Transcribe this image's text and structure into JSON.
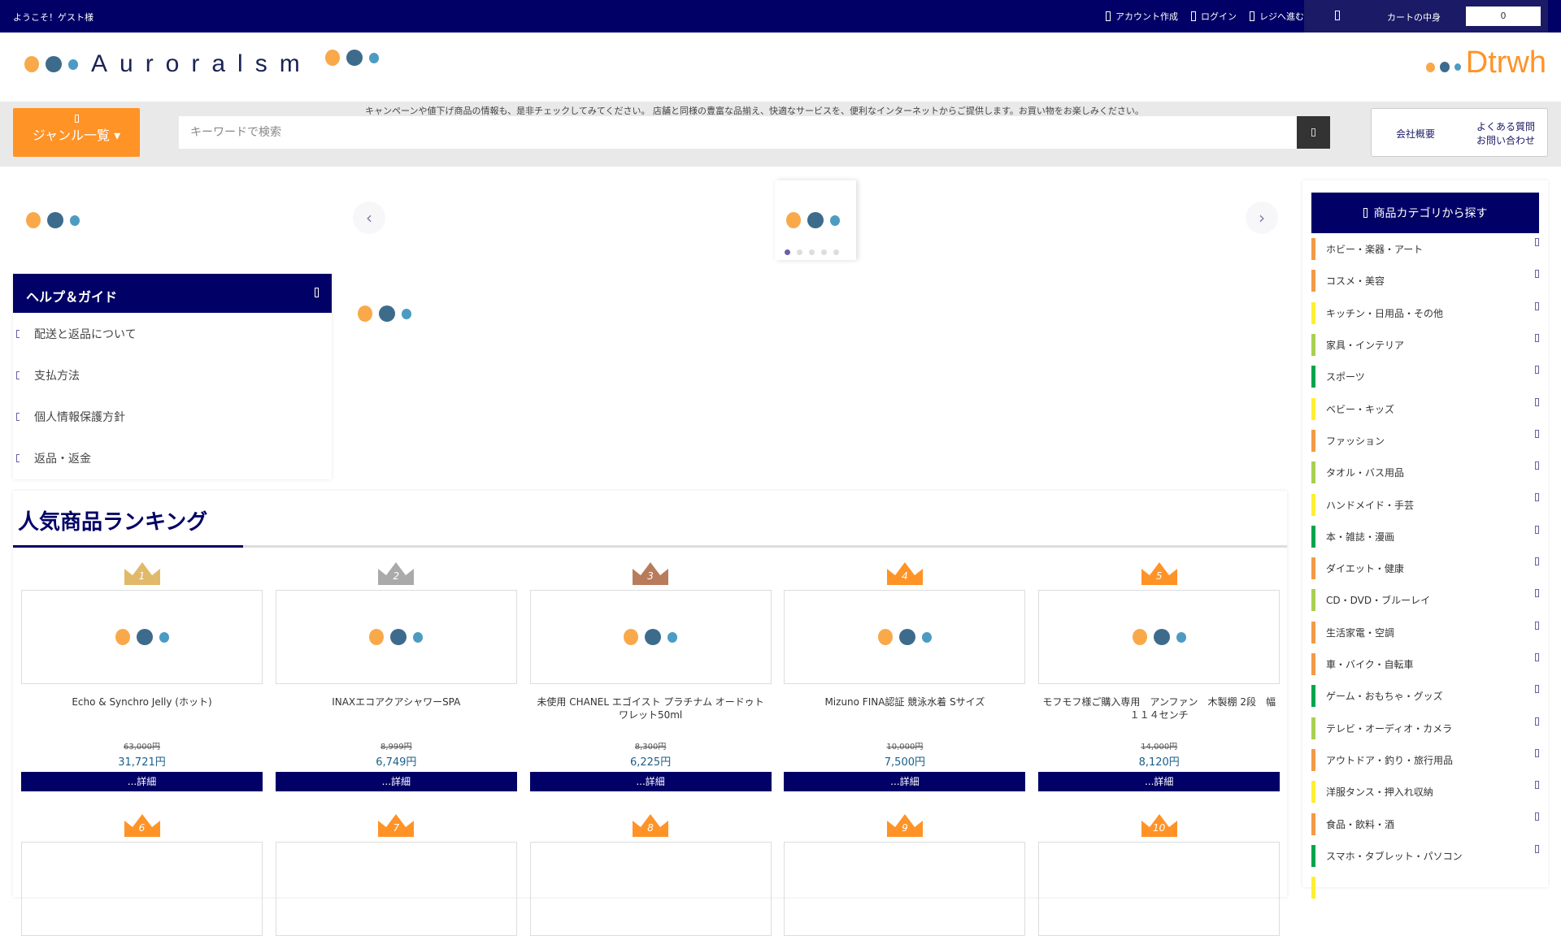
{
  "topbar": {
    "welcome": "ようこそ！ゲスト様",
    "links": [
      "アカウント作成",
      "ログイン",
      "レジへ進む"
    ],
    "cart_label": "カートの中身",
    "cart_count": "0"
  },
  "header": {
    "logo": "Auroralsm",
    "right_logo": "Dtrwh"
  },
  "band": {
    "genre_button": "ジャンル一覧",
    "campaign": "キャンペーンや値下げ商品の情報も、是非チェックしてみてください。 店舗と同様の豊富な品揃え、快適なサービスを、便利なインターネットからご提供します。お買い物をお楽しみください。",
    "search_placeholder": "キーワードで検索",
    "company": "会社概要",
    "faq": "よくある質問",
    "contact": "お問い合わせ"
  },
  "help": {
    "title": "ヘルプ＆ガイド",
    "items": [
      "配送と返品について",
      "支払方法",
      "個人情報保護方針",
      "返品・返金"
    ]
  },
  "ranking": {
    "title": "人気商品ランキング",
    "detail_label": "...詳細",
    "products": [
      {
        "rank": "1",
        "name": "Echo & Synchro Jelly (ホット)",
        "old_price": "63,000円",
        "price": "31,721円"
      },
      {
        "rank": "2",
        "name": "INAXエコアクアシャワーSPA",
        "old_price": "8,999円",
        "price": "6,749円"
      },
      {
        "rank": "3",
        "name": "未使用 CHANEL エゴイスト プラチナム オードゥトワレット50ml",
        "old_price": "8,300円",
        "price": "6,225円"
      },
      {
        "rank": "4",
        "name": "Mizuno FINA認証 競泳水着 Sサイズ",
        "old_price": "10,000円",
        "price": "7,500円"
      },
      {
        "rank": "5",
        "name": "モフモフ様ご購入専用　アンファン　木製棚 2段　幅１１４センチ",
        "old_price": "14,000円",
        "price": "8,120円"
      }
    ],
    "row2_ranks": [
      "6",
      "7",
      "8",
      "9",
      "10"
    ]
  },
  "crown_colors": {
    "1": "#e0b96a",
    "2": "#aaaaaa",
    "3": "#b87c5c",
    "other": "#ff9326"
  },
  "sidebar": {
    "title": "商品カテゴリから探す",
    "categories": [
      {
        "label": "ホビー・楽器・アート",
        "color": "#f39a45"
      },
      {
        "label": "コスメ・美容",
        "color": "#f39a45"
      },
      {
        "label": "キッチン・日用品・その他",
        "color": "#ffee33"
      },
      {
        "label": "家具・インテリア",
        "color": "#a8d050"
      },
      {
        "label": "スポーツ",
        "color": "#00a550"
      },
      {
        "label": "ベビー・キッズ",
        "color": "#ffee33"
      },
      {
        "label": "ファッション",
        "color": "#f39a45"
      },
      {
        "label": "タオル・バス用品",
        "color": "#a8d050"
      },
      {
        "label": "ハンドメイド・手芸",
        "color": "#ffee33"
      },
      {
        "label": "本・雑誌・漫画",
        "color": "#00a550"
      },
      {
        "label": "ダイエット・健康",
        "color": "#f39a45"
      },
      {
        "label": "CD・DVD・ブルーレイ",
        "color": "#a8d050"
      },
      {
        "label": "生活家電・空調",
        "color": "#f39a45"
      },
      {
        "label": "車・バイク・自転車",
        "color": "#f39a45"
      },
      {
        "label": "ゲーム・おもちゃ・グッズ",
        "color": "#00a550"
      },
      {
        "label": "テレビ・オーディオ・カメラ",
        "color": "#a8d050"
      },
      {
        "label": "アウトドア・釣り・旅行用品",
        "color": "#f39a45"
      },
      {
        "label": "洋服タンス・押入れ収納",
        "color": "#ffee33"
      },
      {
        "label": "食品・飲料・酒",
        "color": "#f39a45"
      },
      {
        "label": "スマホ・タブレット・パソコン",
        "color": "#00a550"
      }
    ]
  }
}
